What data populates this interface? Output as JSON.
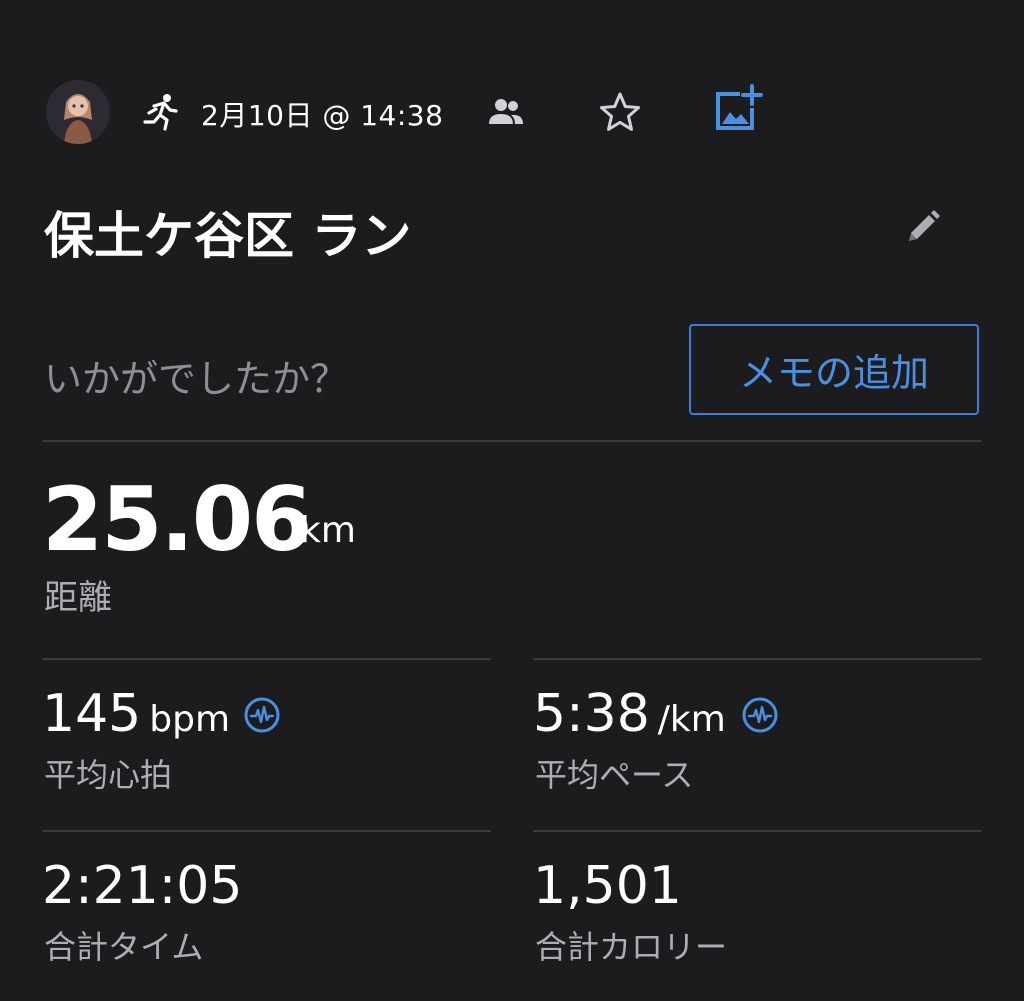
{
  "header": {
    "datetime": "2月10日 @ 14:38"
  },
  "activity": {
    "title": "保土ケ谷区 ラン",
    "feeling_prompt": "いかがでしたか？",
    "memo_button_label": "メモの追加"
  },
  "main_stat": {
    "value": "25.06",
    "unit": "km",
    "label": "距離"
  },
  "stats": [
    {
      "value": "145",
      "unit": "bpm",
      "label": "平均心拍",
      "has_pulse_icon": true
    },
    {
      "value": "5:38",
      "unit": "/km",
      "label": "平均ペース",
      "has_pulse_icon": true
    },
    {
      "value": "2:21:05",
      "unit": "",
      "label": "合計タイム",
      "has_pulse_icon": false
    },
    {
      "value": "1,501",
      "unit": "",
      "label": "合計カロリー",
      "has_pulse_icon": false
    }
  ],
  "colors": {
    "background": "#1c1c1e",
    "accent": "#4a90e2",
    "divider": "#3a3a3c",
    "secondary_text": "#aeaeb2"
  },
  "icons": [
    "avatar",
    "running-icon",
    "people-icon",
    "star-icon",
    "add-photo-icon",
    "pencil-icon",
    "pulse-icon"
  ]
}
